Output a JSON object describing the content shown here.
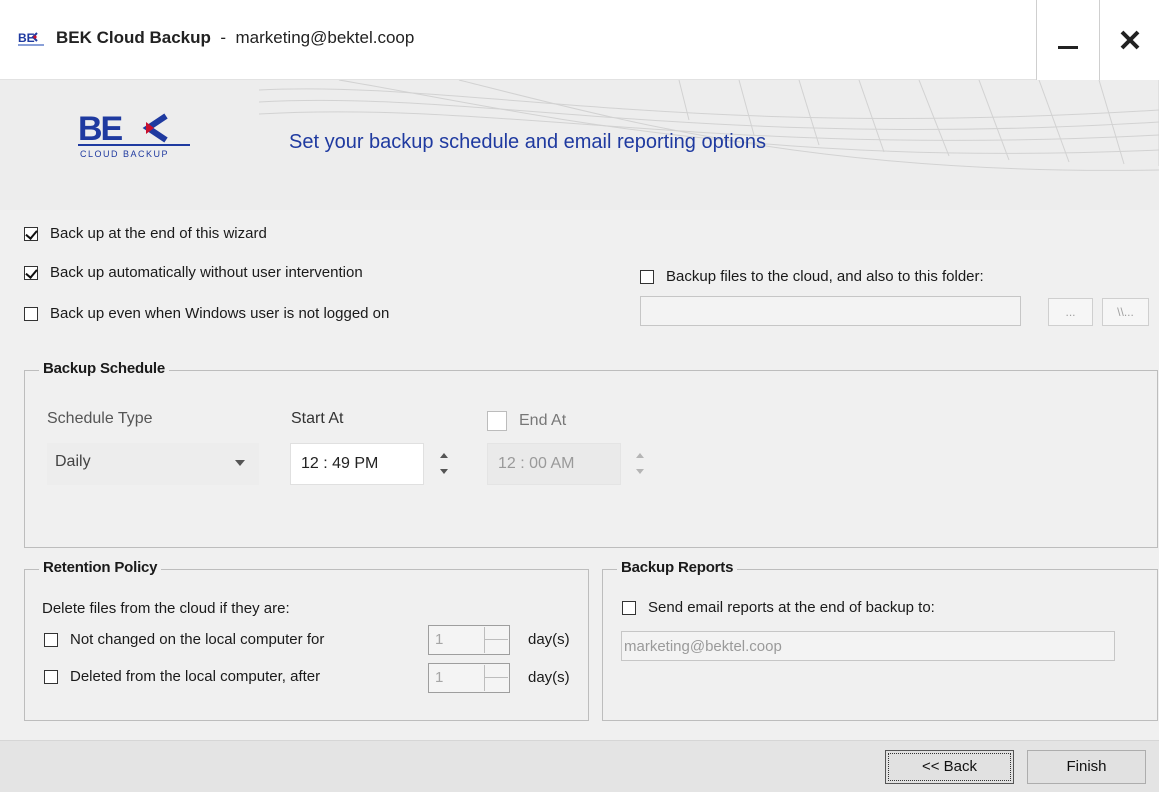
{
  "window": {
    "app_name": "BEK Cloud Backup",
    "separator": "  -  ",
    "account": "marketing@bektel.coop"
  },
  "header": {
    "logo_text": "BEK",
    "logo_subtext": "CLOUD BACKUP",
    "title": "Set your backup schedule and email reporting options"
  },
  "options": {
    "backup_at_end": {
      "label": "Back up at the end of this wizard",
      "checked": true
    },
    "backup_auto": {
      "label": "Back up automatically without user intervention",
      "checked": true
    },
    "backup_not_logged": {
      "label": "Back up even when Windows user is not logged on",
      "checked": false
    },
    "backup_folder": {
      "label": "Backup files to the cloud, and also to this folder:",
      "checked": false,
      "value": ""
    },
    "browse_button": "...",
    "network_button": "\\\\..."
  },
  "schedule": {
    "title": "Backup Schedule",
    "type_label": "Schedule Type",
    "type_value": "Daily",
    "start_label": "Start At",
    "start_value": "12 : 49 PM",
    "end_label": "End At",
    "end_checked": false,
    "end_value": "12 : 00 AM"
  },
  "retention": {
    "title": "Retention Policy",
    "intro": "Delete files from the cloud if they are:",
    "not_changed": {
      "label": "Not changed on the local computer for",
      "checked": false,
      "value": "1",
      "unit": "day(s)"
    },
    "deleted": {
      "label": "Deleted from the local computer, after",
      "checked": false,
      "value": "1",
      "unit": "day(s)"
    }
  },
  "reports": {
    "title": "Backup Reports",
    "send_label": "Send email reports at the end of backup to:",
    "send_checked": false,
    "email": "marketing@bektel.coop"
  },
  "footer": {
    "back_button": "<< Back",
    "finish_button": "Finish"
  },
  "colors": {
    "brand_blue": "#1f3aa0",
    "brand_red": "#c8102e"
  }
}
